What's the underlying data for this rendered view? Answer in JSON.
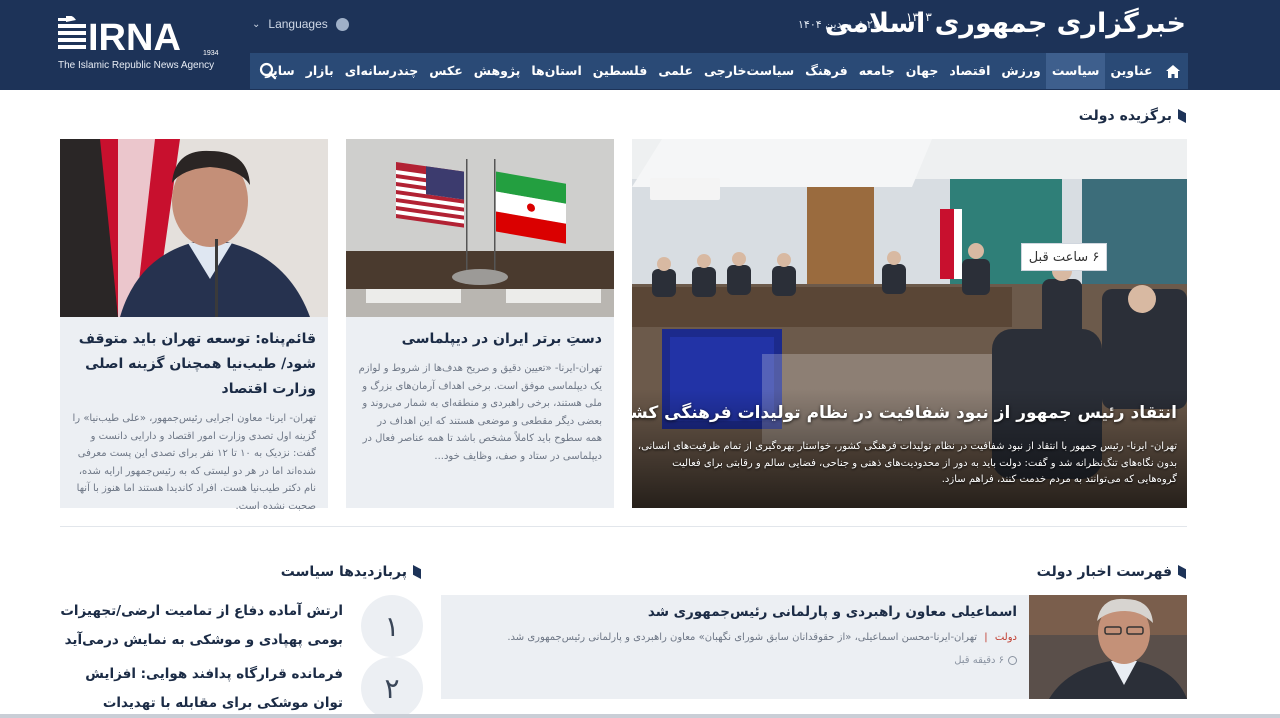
{
  "header": {
    "logo_text": "IRNA",
    "logo_year": "1934",
    "logo_subtitle": "The Islamic Republic News Agency",
    "languages_label": "Languages",
    "date": "۲۴ فروردین ۱۴۰۴",
    "brand_title": "خبرگزاری جمهوری اسلامی",
    "brand_year": "۱۳۱۳"
  },
  "nav": {
    "items": [
      "عناوین",
      "سیاست",
      "ورزش",
      "اقتصاد",
      "جهان",
      "جامعه",
      "فرهنگ",
      "سیاست‌خارجی",
      "علمی",
      "فلسطین",
      "استان‌ها",
      "پژوهش",
      "عکس",
      "چندرسانه‌ای",
      "بازار",
      "سایر"
    ],
    "active": "سیاست"
  },
  "featured": {
    "section_title": "برگزیده دولت",
    "main": {
      "badge": "۶ ساعت قبل",
      "title": "انتقاد رئیس جمهور از نبود شفافیت در نظام تولیدات فرهنگی کشور",
      "lead": "تهران- ایرنا- رئیس جمهور با انتقاد از نبود شفافیت در نظام تولیدات فرهنگی کشور، خواستار بهره‌گیری از تمام ظرفیت‌های انسانی، بدون نگاه‌های تنگ‌نظرانه شد و گفت: دولت باید به دور از محدودیت‌های ذهنی و جناحی، فضایی سالم و رقابتی برای فعالیت گروه‌هایی که می‌توانند به مردم خدمت کنند، فراهم سازد."
    },
    "card2": {
      "title": "دستِ برتر ایران در دیپلماسی",
      "lead": "تهران-ایرنا- «تعیین دقیق و صریح هدف‌ها از شروط و لوازم یک دیپلماسی موفق است. برخی اهداف آرمان‌های بزرگ و ملی هستند، برخی راهبردی و منطقه‌ای به شمار می‌روند و بعضی دیگر مقطعی و موضعی هستند که این اهداف در همه سطوح باید کاملاً مشخص باشد تا همه عناصر فعال در دیپلماسی در ستاد و صف، وظایف خود..."
    },
    "card3": {
      "title": "قائم‌پناه: توسعه تهران باید متوقف شود/ طیب‌نیا همچنان گزینه اصلی وزارت اقتصاد",
      "lead": "تهران- ایرنا- معاون اجرایی رئیس‌جمهور، «علی طیب‌نیا» را گزینه اول تصدی وزارت امور اقتصاد و دارایی دانست و گفت: نزدیک به ۱۰ تا ۱۲ نفر برای تصدی این پست معرفی شده‌اند اما در هر دو لیستی که به رئیس‌جمهور ارایه شده، نام دکتر طیب‌نیا هست. افراد کاندیدا هستند اما هنوز با آنها صحبت نشده است."
    }
  },
  "news_list": {
    "section_title": "فهرست اخبار دولت",
    "item": {
      "title": "اسماعیلی معاون راهبردی و پارلمانی رئیس‌جمهوری شد",
      "category": "دولت",
      "separator": "|",
      "lead": "تهران-ایرنا-محسن اسماعیلی، «از حقوقدانان سابق شورای نگهبان» معاون راهبردی و پارلمانی رئیس‌جمهوری شد.",
      "time": "۶ دقیقه قبل"
    }
  },
  "popular": {
    "section_title": "پربازدیدها سیاست",
    "items": [
      {
        "num": "۱",
        "title": "ارتش آماده دفاع از تمامیت ارضی/تجهیزات بومی پهپادی و موشکی به نمایش درمی‌آید"
      },
      {
        "num": "۲",
        "title": "فرمانده قرارگاه پدافند هوایی: افزایش توان موشکی برای مقابله با تهدیدات احتمالی است"
      }
    ]
  },
  "colors": {
    "header_bg": "#1d3358",
    "nav_bg": "#2a4a76",
    "nav_active": "#3e5f8d",
    "card_bg": "#eceff3",
    "category_red": "#c0392b"
  },
  "icons": [
    "home-icon",
    "search-icon",
    "globe-icon",
    "chevron-down-icon",
    "clock-icon"
  ]
}
